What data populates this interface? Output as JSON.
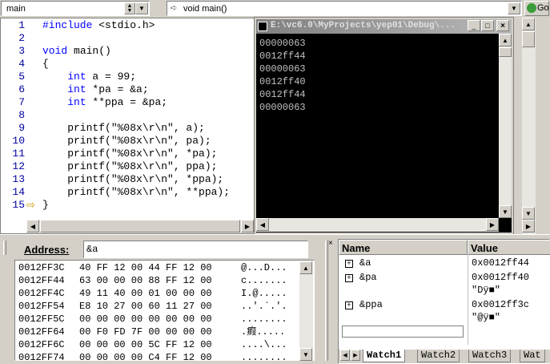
{
  "toolbar": {
    "scope_combo": "main",
    "function_combo": "void main()",
    "go_label": "Go"
  },
  "editor": {
    "lines": [
      {
        "no": "1",
        "text": "#include <stdio.h>"
      },
      {
        "no": "2",
        "text": ""
      },
      {
        "no": "3",
        "text": "void main()"
      },
      {
        "no": "4",
        "text": "{"
      },
      {
        "no": "5",
        "text": "    int a = 99;"
      },
      {
        "no": "6",
        "text": "    int *pa = &a;"
      },
      {
        "no": "7",
        "text": "    int **ppa = &pa;"
      },
      {
        "no": "8",
        "text": ""
      },
      {
        "no": "9",
        "text": "    printf(\"%08x\\r\\n\", a);"
      },
      {
        "no": "10",
        "text": "    printf(\"%08x\\r\\n\", pa);"
      },
      {
        "no": "11",
        "text": "    printf(\"%08x\\r\\n\", *pa);"
      },
      {
        "no": "12",
        "text": "    printf(\"%08x\\r\\n\", ppa);"
      },
      {
        "no": "13",
        "text": "    printf(\"%08x\\r\\n\", *ppa);"
      },
      {
        "no": "14",
        "text": "    printf(\"%08x\\r\\n\", **ppa);"
      },
      {
        "no": "15",
        "text": "}"
      }
    ]
  },
  "console": {
    "title": "E:\\vc6.0\\MyProjects\\yep01\\Debug\\...",
    "lines": [
      "00000063",
      "0012ff44",
      "00000063",
      "0012ff40",
      "0012ff44",
      "00000063"
    ]
  },
  "memory": {
    "address_label": "Address:",
    "address_value": "&a",
    "rows": [
      {
        "addr": "0012FF3C",
        "bytes": "40 FF 12 00 44 FF 12 00",
        "ascii": "@...D..."
      },
      {
        "addr": "0012FF44",
        "bytes": "63 00 00 00 88 FF 12 00",
        "ascii": "c......."
      },
      {
        "addr": "0012FF4C",
        "bytes": "49 11 40 00 01 00 00 00",
        "ascii": "I.@....."
      },
      {
        "addr": "0012FF54",
        "bytes": "E8 10 27 00 60 11 27 00",
        "ascii": "..'.`.'."
      },
      {
        "addr": "0012FF5C",
        "bytes": "00 00 00 00 00 00 00 00",
        "ascii": "........"
      },
      {
        "addr": "0012FF64",
        "bytes": "00 F0 FD 7F 00 00 00 00",
        "ascii": ".瘕....."
      },
      {
        "addr": "0012FF6C",
        "bytes": "00 00 00 00 5C FF 12 00",
        "ascii": "....\\..."
      },
      {
        "addr": "0012FF74",
        "bytes": "00 00 00 00 C4 FF 12 00",
        "ascii": "........"
      }
    ]
  },
  "watch": {
    "col_name": "Name",
    "col_value": "Value",
    "rows": [
      {
        "name": "&a",
        "value": "0x0012ff44",
        "value2": ""
      },
      {
        "name": "&pa",
        "value": "0x0012ff40",
        "value2": "\"Dÿ■\""
      },
      {
        "name": "&ppa",
        "value": "0x0012ff3c",
        "value2": "\"@ÿ■\""
      }
    ],
    "tabs": [
      "Watch1",
      "Watch2",
      "Watch3",
      "Wat"
    ]
  },
  "icons": {
    "debug_arrow": "current-line-arrow",
    "dropdown": "chevron-down-icon"
  }
}
